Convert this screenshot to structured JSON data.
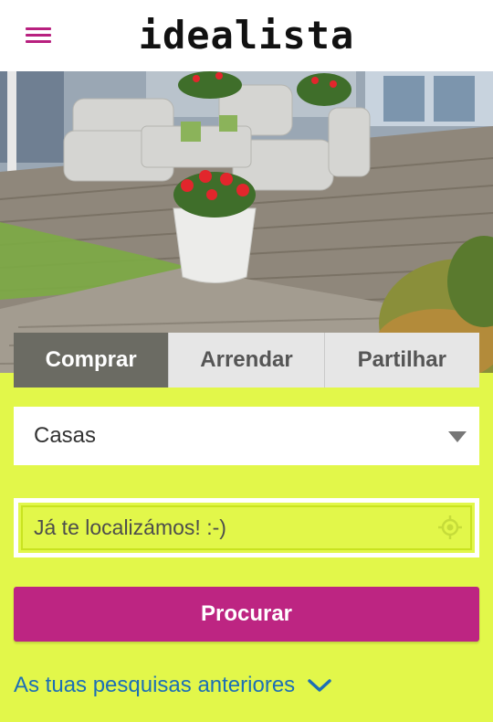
{
  "header": {
    "logo_text": "idealista",
    "menu_icon": "hamburger-menu-icon",
    "brand_color": "#bd2582"
  },
  "hero": {
    "description_icon": "terrace-photo"
  },
  "tabs": [
    {
      "label": "Comprar",
      "active": true
    },
    {
      "label": "Arrendar",
      "active": false
    },
    {
      "label": "Partilhar",
      "active": false
    }
  ],
  "property_type": {
    "selected": "Casas",
    "icon": "dropdown-arrow-icon"
  },
  "location": {
    "value": "Já te localizámos! :-)",
    "icon": "locate-target-icon"
  },
  "search_button": {
    "label": "Procurar",
    "color": "#bd2582"
  },
  "previous_searches": {
    "label": "As tuas pesquisas anteriores",
    "icon": "chevron-down-icon",
    "color": "#1d6fb5"
  },
  "colors": {
    "background": "#e2f74a",
    "active_tab": "#6b6b63"
  }
}
